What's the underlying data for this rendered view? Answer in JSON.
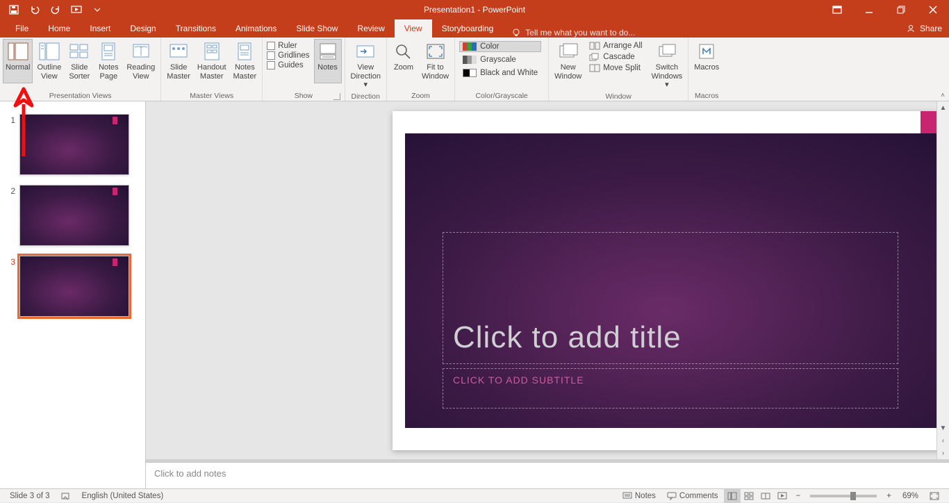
{
  "app_title": "Presentation1 - PowerPoint",
  "qat": {
    "save": "Save",
    "undo": "Undo",
    "redo": "Redo",
    "start": "Start From Beginning"
  },
  "tabs": {
    "file": "File",
    "items": [
      "Home",
      "Insert",
      "Design",
      "Transitions",
      "Animations",
      "Slide Show",
      "Review",
      "View",
      "Storyboarding"
    ],
    "active": "View",
    "tellme": "Tell me what you want to do...",
    "share": "Share"
  },
  "ribbon": {
    "presentation_views": {
      "label": "Presentation Views",
      "normal": "Normal",
      "outline": "Outline\nView",
      "sorter": "Slide\nSorter",
      "notes_page": "Notes\nPage",
      "reading": "Reading\nView"
    },
    "master_views": {
      "label": "Master Views",
      "slide_master": "Slide\nMaster",
      "handout_master": "Handout\nMaster",
      "notes_master": "Notes\nMaster"
    },
    "show": {
      "label": "Show",
      "ruler": "Ruler",
      "gridlines": "Gridlines",
      "guides": "Guides",
      "notes_btn": "Notes"
    },
    "direction": {
      "label": "Direction",
      "view_direction": "View\nDirection"
    },
    "zoom": {
      "label": "Zoom",
      "zoom": "Zoom",
      "fit": "Fit to\nWindow"
    },
    "color_grayscale": {
      "label": "Color/Grayscale",
      "color": "Color",
      "grayscale": "Grayscale",
      "bw": "Black and White"
    },
    "window": {
      "label": "Window",
      "new_window": "New\nWindow",
      "arrange": "Arrange All",
      "cascade": "Cascade",
      "move_split": "Move Split",
      "switch": "Switch\nWindows"
    },
    "macros": {
      "label": "Macros",
      "macros": "Macros"
    }
  },
  "slides": {
    "count": 3,
    "selected": 3,
    "nums": [
      "1",
      "2",
      "3"
    ]
  },
  "slide_content": {
    "title_placeholder": "Click to add title",
    "subtitle_placeholder": "CLICK TO ADD SUBTITLE"
  },
  "notes_placeholder": "Click to add notes",
  "status": {
    "slide_info": "Slide 3 of 3",
    "language": "English (United States)",
    "notes_btn": "Notes",
    "comments_btn": "Comments",
    "zoom_pct": "69%"
  }
}
